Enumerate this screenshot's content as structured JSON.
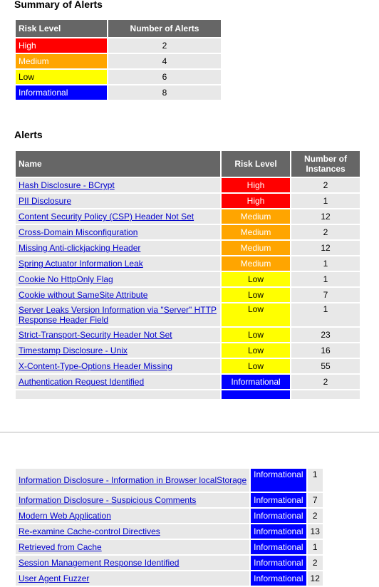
{
  "summary": {
    "heading": "Summary of Alerts",
    "headers": {
      "risk_level": "Risk Level",
      "count": "Number of Alerts"
    },
    "rows": [
      {
        "level": "High",
        "count": "2"
      },
      {
        "level": "Medium",
        "count": "4"
      },
      {
        "level": "Low",
        "count": "6"
      },
      {
        "level": "Informational",
        "count": "8"
      }
    ]
  },
  "alerts": {
    "heading": "Alerts",
    "headers": {
      "name": "Name",
      "risk_level": "Risk Level",
      "instances": "Number of Instances"
    },
    "rows": [
      {
        "name": "Hash Disclosure - BCrypt",
        "risk": "High",
        "instances": "2"
      },
      {
        "name": "PII Disclosure",
        "risk": "High",
        "instances": "1"
      },
      {
        "name": "Content Security Policy (CSP) Header Not Set",
        "risk": "Medium",
        "instances": "12"
      },
      {
        "name": "Cross-Domain Misconfiguration",
        "risk": "Medium",
        "instances": "2"
      },
      {
        "name": "Missing Anti-clickjacking Header",
        "risk": "Medium",
        "instances": "12"
      },
      {
        "name": "Spring Actuator Information Leak",
        "risk": "Medium",
        "instances": "1"
      },
      {
        "name": "Cookie No HttpOnly Flag",
        "risk": "Low",
        "instances": "1"
      },
      {
        "name": "Cookie without SameSite Attribute",
        "risk": "Low",
        "instances": "7"
      },
      {
        "name": "Server Leaks Version Information via \"Server\" HTTP Response Header Field",
        "risk": "Low",
        "instances": "1"
      },
      {
        "name": "Strict-Transport-Security Header Not Set",
        "risk": "Low",
        "instances": "23"
      },
      {
        "name": "Timestamp Disclosure - Unix",
        "risk": "Low",
        "instances": "16"
      },
      {
        "name": "X-Content-Type-Options Header Missing",
        "risk": "Low",
        "instances": "55"
      },
      {
        "name": "Authentication Request Identified",
        "risk": "Informational",
        "instances": "2"
      }
    ],
    "rows_continued": [
      {
        "name": "Information Disclosure - Information in Browser localStorage",
        "risk": "Informational",
        "instances": "1"
      },
      {
        "name": "Information Disclosure - Suspicious Comments",
        "risk": "Informational",
        "instances": "7"
      },
      {
        "name": "Modern Web Application",
        "risk": "Informational",
        "instances": "2"
      },
      {
        "name": "Re-examine Cache-control Directives",
        "risk": "Informational",
        "instances": "13"
      },
      {
        "name": "Retrieved from Cache",
        "risk": "Informational",
        "instances": "1"
      },
      {
        "name": "Session Management Response Identified",
        "risk": "Informational",
        "instances": "2"
      },
      {
        "name": "User Agent Fuzzer",
        "risk": "Informational",
        "instances": "12"
      }
    ]
  },
  "colors": {
    "high": "#ff0000",
    "medium": "#ffa500",
    "low": "#ffff00",
    "informational": "#0000ff",
    "header": "#666666"
  }
}
